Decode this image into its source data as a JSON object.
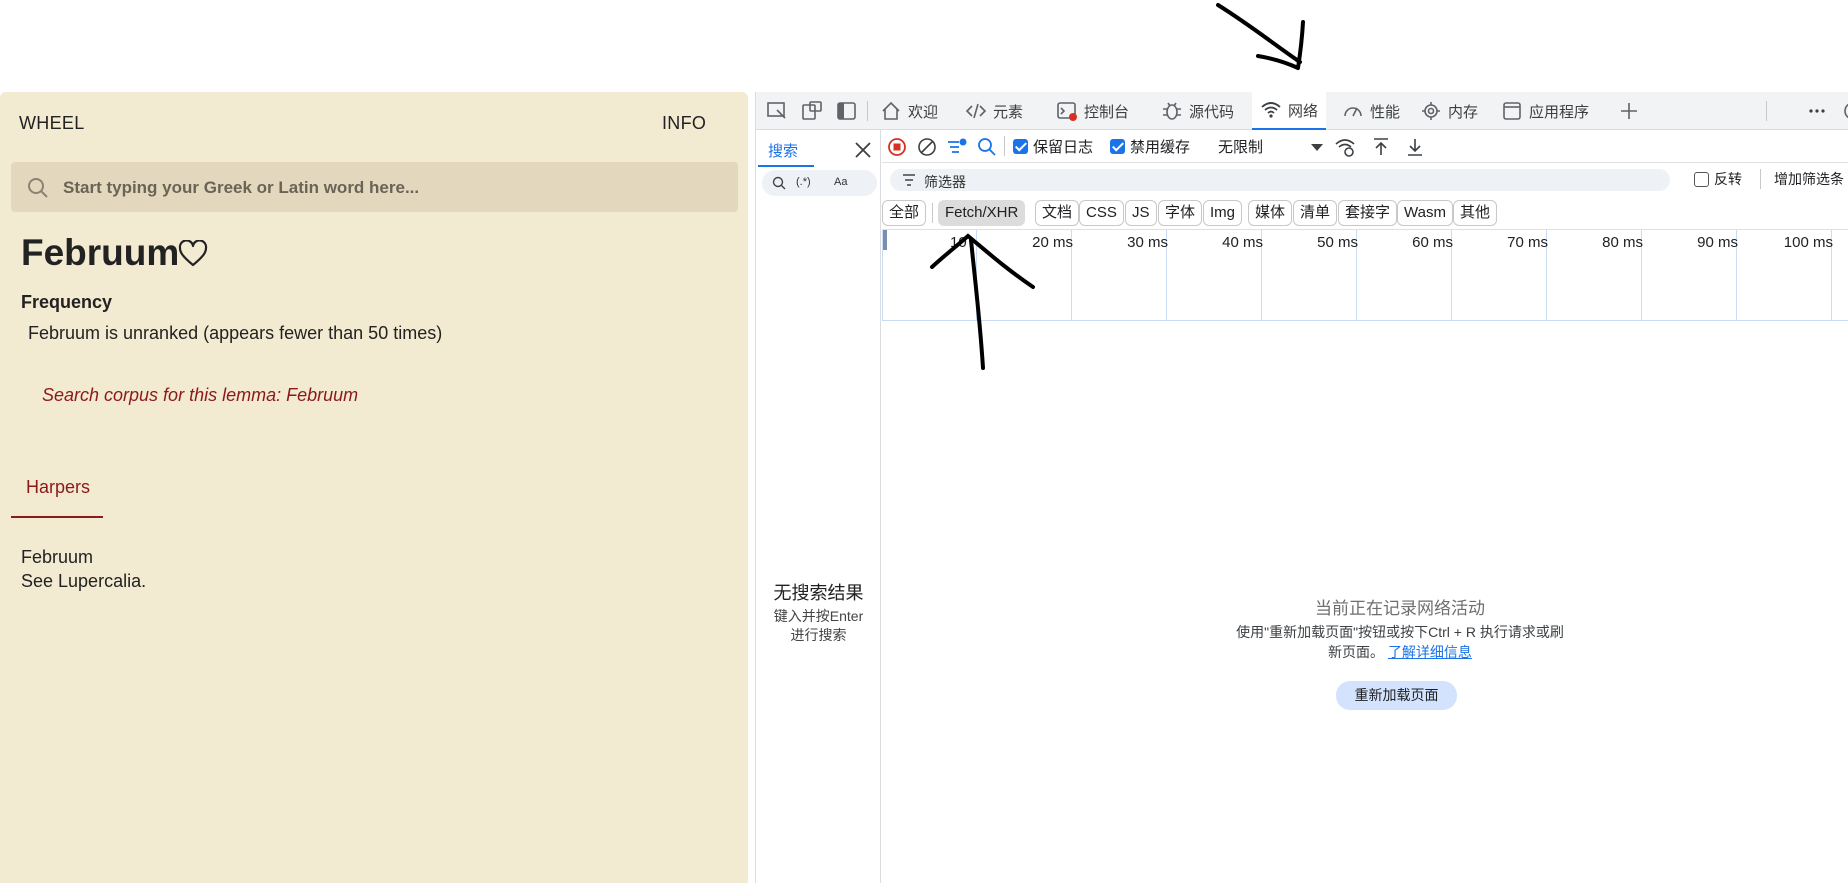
{
  "app": {
    "brand": "WHEEL",
    "info": "INFO",
    "search_placeholder": "Start typing your Greek or Latin word here...",
    "word": "Februum",
    "frequency_heading": "Frequency",
    "frequency_text": "Februum is unranked (appears fewer than 50 times)",
    "corpus_link": "Search corpus for this lemma: Februum",
    "tab": "Harpers",
    "entry_headword": "Februum",
    "entry_body": "See Lupercalia."
  },
  "devtools": {
    "tabs": [
      "欢迎",
      "元素",
      "控制台",
      "源代码",
      "网络",
      "性能",
      "内存",
      "应用程序"
    ],
    "active_tab": "网络",
    "search_pane": {
      "tab": "搜索",
      "regex_label": "(.*)",
      "case_label": "Aa",
      "no_results": "无搜索结果",
      "hint_line1": "键入并按Enter",
      "hint_line2": "进行搜索"
    },
    "toolbar": {
      "preserve_log": "保留日志",
      "disable_cache": "禁用缓存",
      "throttle": "无限制"
    },
    "filter": {
      "placeholder": "筛选器",
      "invert": "反转",
      "more_filters": "增加筛选条"
    },
    "type_filters": [
      "全部",
      "Fetch/XHR",
      "文档",
      "CSS",
      "JS",
      "字体",
      "Img",
      "媒体",
      "清单",
      "套接字",
      "Wasm",
      "其他"
    ],
    "selected_filter": "Fetch/XHR",
    "timeline_ticks": [
      "10",
      "20 ms",
      "30 ms",
      "40 ms",
      "50 ms",
      "60 ms",
      "70 ms",
      "80 ms",
      "90 ms",
      "100 ms"
    ],
    "recording": {
      "title": "当前正在记录网络活动",
      "desc": "使用\"重新加载页面\"按钮或按下Ctrl + R 执行请求或刷新页面。",
      "link": "了解详细信息",
      "reload_button": "重新加载页面"
    }
  },
  "colors": {
    "app_bg": "#f3ead2",
    "accent_red": "#8b1a1a",
    "devtools_blue": "#1a73e8"
  }
}
